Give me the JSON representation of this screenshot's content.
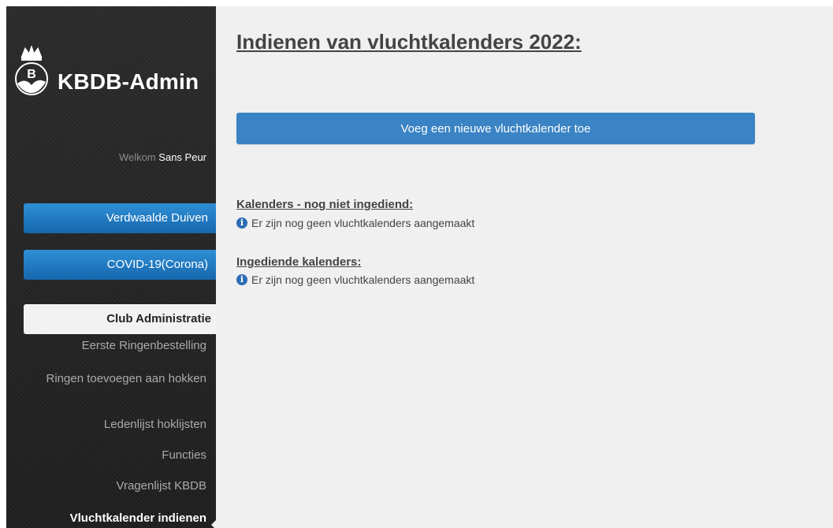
{
  "brand": {
    "name": "KBDB-Admin",
    "logo_icon": "kbdb-crown-pigeon-logo"
  },
  "welcome": {
    "prefix": "Welkom",
    "user": "Sans Peur"
  },
  "sidebar": {
    "buttons": [
      {
        "label": "Verdwaalde Duiven"
      },
      {
        "label": "COVID-19(Corona)"
      }
    ],
    "section": "Club Administratie",
    "links": [
      {
        "label": "Eerste Ringenbestelling"
      },
      {
        "label": "Ringen toevoegen aan hokken"
      },
      {
        "label": "Ledenlijst hoklijsten"
      },
      {
        "label": "Functies"
      },
      {
        "label": "Vragenlijst KBDB"
      },
      {
        "label": "Vluchtkalender indienen"
      }
    ]
  },
  "main": {
    "title": "Indienen van vluchtkalenders 2022:",
    "add_button": "Voeg een nieuwe vluchtkalender toe",
    "sections": [
      {
        "heading": "Kalenders - nog niet ingediend:",
        "info": "Er zijn nog geen vluchtkalenders aangemaakt"
      },
      {
        "heading": "Ingediende kalenders:",
        "info": "Er zijn nog geen vluchtkalenders aangemaakt"
      }
    ],
    "info_icon": "info-circle-icon"
  },
  "colors": {
    "primary_button": "#3a83c4",
    "sidebar_button": "#1e7bc4",
    "sidebar_bg": "#252525",
    "main_bg": "#f0f0f0"
  }
}
